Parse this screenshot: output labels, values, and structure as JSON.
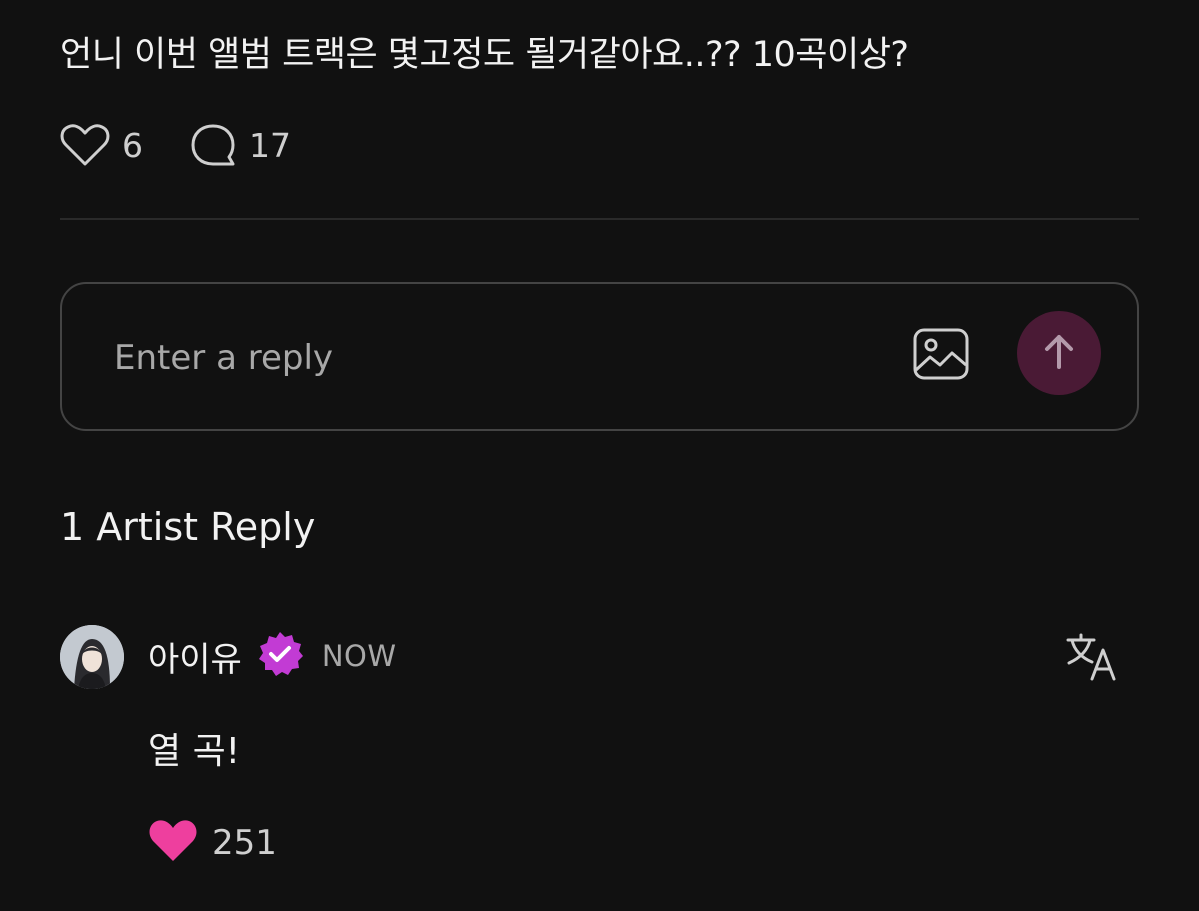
{
  "post": {
    "text": "언니 이번 앨범 트랙은 몇고정도 될거같아요..?? 10곡이상?",
    "likes": "6",
    "comments": "17"
  },
  "reply_box": {
    "placeholder": "Enter a reply",
    "image_icon": "image-icon",
    "send_icon": "arrow-up-icon"
  },
  "replies_section": {
    "title": "1 Artist Reply"
  },
  "reply": {
    "author": "아이유",
    "badge_icon": "verified-badge-icon",
    "time": "NOW",
    "text": "열 곡!",
    "likes": "251",
    "translate_icon": "translate-icon"
  },
  "colors": {
    "background": "#111111",
    "send_button": "#4a1a35",
    "badge": "#c23bd4",
    "like_heart": "#ee3f9e"
  }
}
